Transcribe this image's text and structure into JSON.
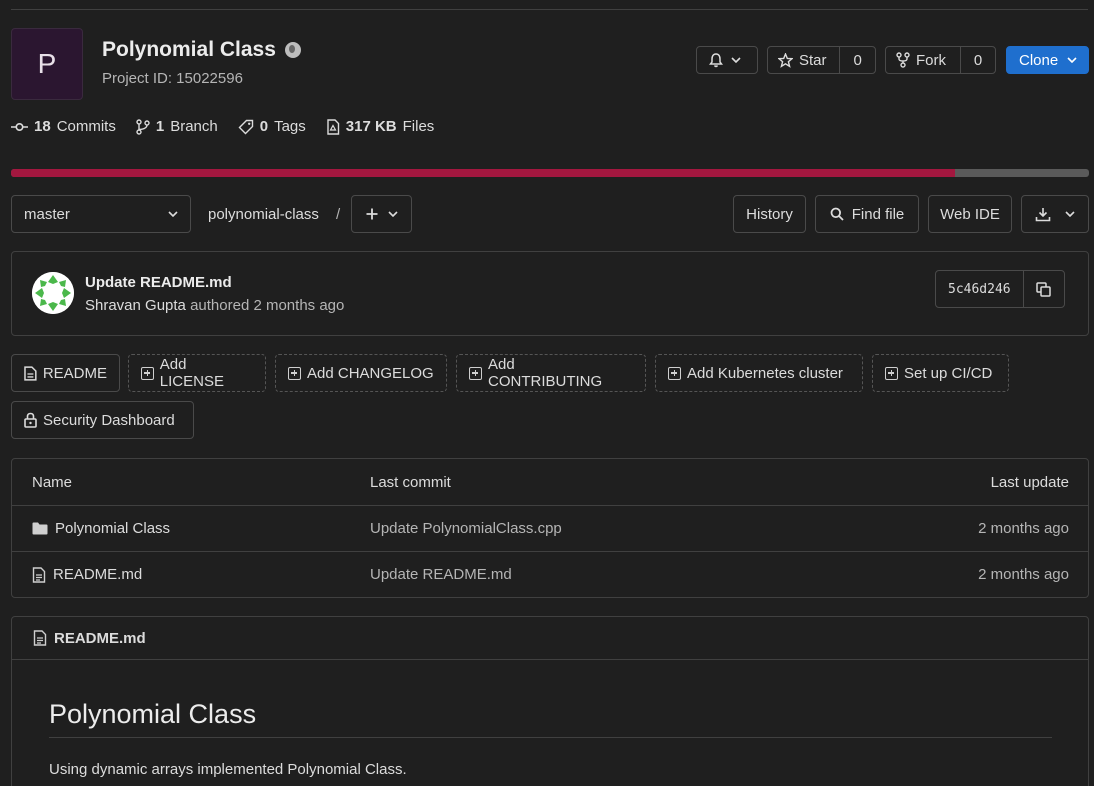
{
  "project": {
    "avatar_letter": "P",
    "name": "Polynomial Class",
    "visibility_icon": "globe-icon",
    "project_id_label": "Project ID: 15022596"
  },
  "header_actions": {
    "notification_icon": "bell-icon",
    "star_label": "Star",
    "star_count": "0",
    "fork_label": "Fork",
    "fork_count": "0",
    "clone_label": "Clone"
  },
  "stats": {
    "commits_count": "18",
    "commits_label": "Commits",
    "branch_count": "1",
    "branch_label": "Branch",
    "tags_count": "0",
    "tags_label": "Tags",
    "files_size": "317 KB",
    "files_label": "Files"
  },
  "language_bar": {
    "primary_fraction": 0.876,
    "primary_color": "#a3173f",
    "rest_color": "#5a5a5a"
  },
  "toolbar": {
    "branch": "master",
    "path": "polynomial-class",
    "path_separator": "/",
    "history_label": "History",
    "find_file_label": "Find file",
    "web_ide_label": "Web IDE"
  },
  "last_commit": {
    "message": "Update README.md",
    "author": "Shravan Gupta",
    "authored_text": "authored 2 months ago",
    "sha": "5c46d246"
  },
  "quick_actions": {
    "readme": "README",
    "add_license": "Add LICENSE",
    "add_changelog": "Add CHANGELOG",
    "add_contributing": "Add CONTRIBUTING",
    "add_kubernetes": "Add Kubernetes cluster",
    "setup_cicd": "Set up CI/CD",
    "security_dashboard": "Security Dashboard"
  },
  "file_table": {
    "headers": {
      "name": "Name",
      "last_commit": "Last commit",
      "last_update": "Last update"
    },
    "rows": [
      {
        "name": "Polynomial Class",
        "icon": "folder-icon",
        "last_commit": "Update PolynomialClass.cpp",
        "last_update": "2 months ago"
      },
      {
        "name": "README.md",
        "icon": "file-icon",
        "last_commit": "Update README.md",
        "last_update": "2 months ago"
      }
    ]
  },
  "readme": {
    "filename": "README.md",
    "heading": "Polynomial Class",
    "body": "Using dynamic arrays implemented Polynomial Class."
  }
}
